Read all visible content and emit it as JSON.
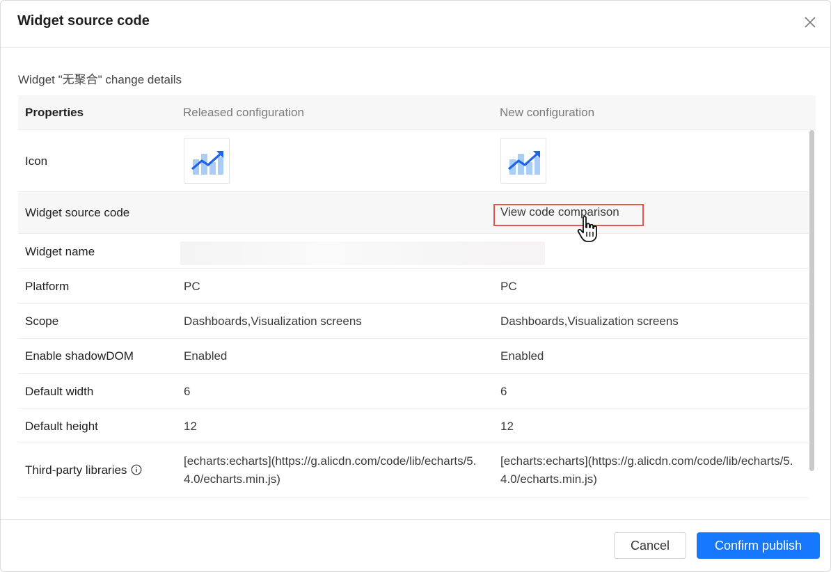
{
  "dialog": {
    "title": "Widget source code",
    "subtitle": "Widget \"无聚合\" change details"
  },
  "table": {
    "headers": {
      "properties": "Properties",
      "released": "Released configuration",
      "new": "New configuration"
    },
    "rows": {
      "icon": {
        "label": "Icon"
      },
      "source": {
        "label": "Widget source code",
        "new_link": "View code comparison"
      },
      "name": {
        "label": "Widget name"
      },
      "platform": {
        "label": "Platform",
        "released": "PC",
        "new": "PC"
      },
      "scope": {
        "label": "Scope",
        "released": "Dashboards,Visualization screens",
        "new": "Dashboards,Visualization screens"
      },
      "shadow": {
        "label": "Enable shadowDOM",
        "released": "Enabled",
        "new": "Enabled"
      },
      "width": {
        "label": "Default width",
        "released": "6",
        "new": "6"
      },
      "height": {
        "label": "Default height",
        "released": "12",
        "new": "12"
      },
      "libs": {
        "label": "Third-party libraries",
        "released": "[echarts:echarts](https://g.alicdn.com/code/lib/echarts/5.4.0/echarts.min.js)",
        "new": "[echarts:echarts](https://g.alicdn.com/code/lib/echarts/5.4.0/echarts.min.js)"
      }
    }
  },
  "footer": {
    "cancel_label": "Cancel",
    "confirm_label": "Confirm publish"
  },
  "colors": {
    "primary": "#1677ff",
    "link": "#3b82f6",
    "highlight": "#e8534a"
  },
  "icons": [
    "close-icon",
    "chart-trend-icon",
    "info-icon",
    "hand-pointer-cursor-icon"
  ]
}
